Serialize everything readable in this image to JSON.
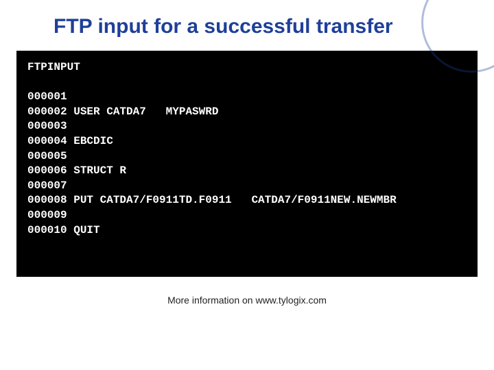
{
  "title": "FTP input for a successful transfer",
  "terminal": {
    "header": "FTPINPUT",
    "lines": [
      "000001",
      "000002 USER CATDA7   MYPASWRD",
      "000003",
      "000004 EBCDIC",
      "000005",
      "000006 STRUCT R",
      "000007",
      "000008 PUT CATDA7/F0911TD.F0911   CATDA7/F0911NEW.NEWMBR",
      "000009",
      "000010 QUIT"
    ]
  },
  "footer": "More information on www.tylogix.com"
}
